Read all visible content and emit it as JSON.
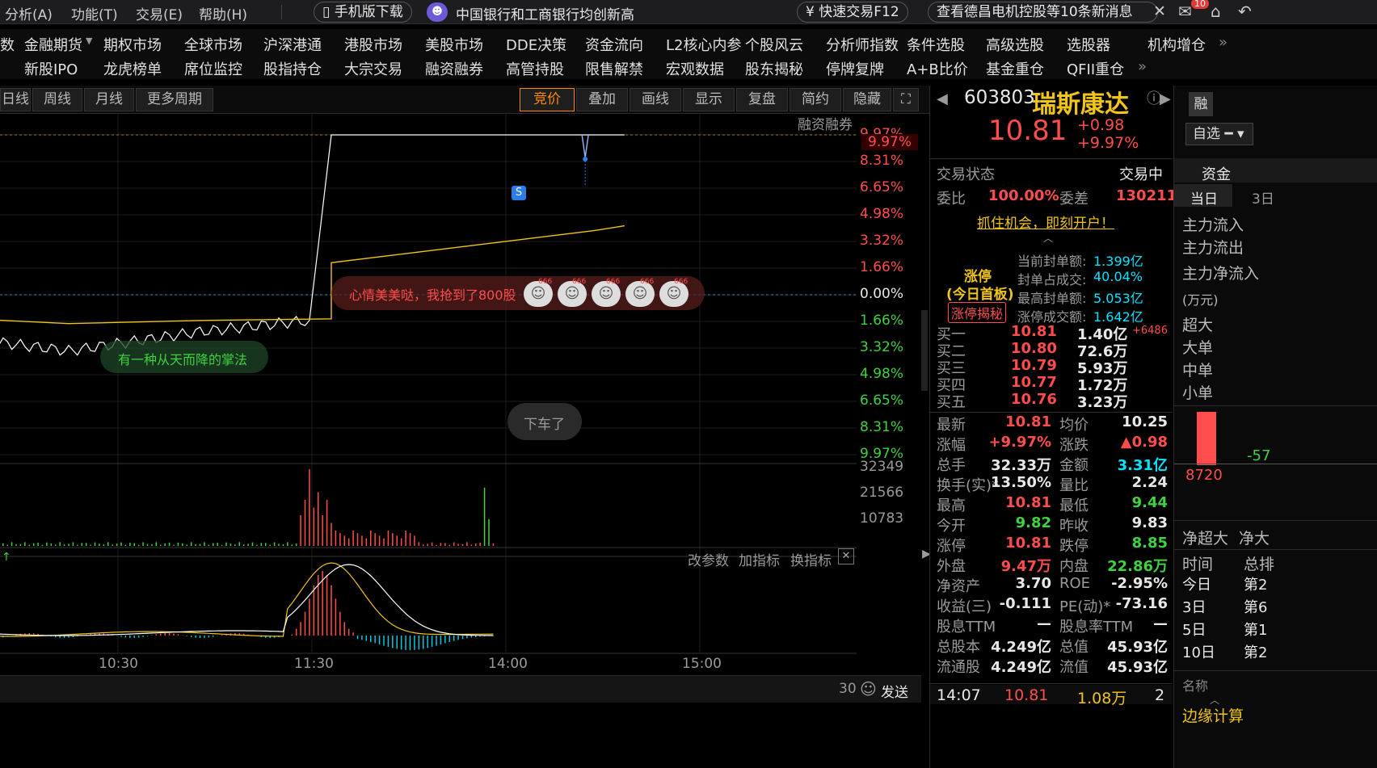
{
  "menu": {
    "items": [
      "分析(A)",
      "功能(T)",
      "交易(E)",
      "帮助(H)"
    ],
    "mobile_download": "手机版下载",
    "news_headline": "中国银行和工商银行均创新高",
    "quick_trade": "快速交易F12",
    "news_alert": "查看德昌电机控股等10条新消息",
    "mail_badge": "10"
  },
  "nav_row1": [
    "数",
    "金融期货",
    "期权市场",
    "全球市场",
    "沪深港通",
    "港股市场",
    "美股市场",
    "DDE决策",
    "资金流向",
    "L2核心内参",
    "个股风云",
    "分析师指数",
    "条件选股",
    "高级选股",
    "选股器",
    "机构增仓"
  ],
  "nav_row2": [
    "",
    "新股IPO",
    "龙虎榜单",
    "席位监控",
    "股指持仓",
    "大宗交易",
    "融资融券",
    "高管持股",
    "限售解禁",
    "宏观数据",
    "股东揭秘",
    "停牌复牌",
    "A+B比价",
    "基金重仓",
    "QFII重仓"
  ],
  "period_bar": {
    "left": [
      "日线",
      "周线",
      "月线",
      "更多周期"
    ],
    "right": [
      "竞价",
      "叠加",
      "画线",
      "显示",
      "复盘",
      "简约",
      "隐藏"
    ]
  },
  "chart": {
    "margin_label": "融资融券",
    "price_axis_labels": [
      "9.97%",
      "8.31%",
      "6.65%",
      "4.98%",
      "3.32%",
      "1.66%",
      "0.00%",
      "1.66%",
      "3.32%",
      "4.98%",
      "6.65%",
      "8.31%",
      "9.97%"
    ],
    "volume_axis_labels": [
      "32349",
      "21566",
      "10783"
    ],
    "time_labels": [
      "10:30",
      "11:30",
      "14:00",
      "15:00"
    ],
    "indicator_toolbar": [
      "改参数",
      "加指标",
      "换指标"
    ],
    "signal_marker": "S",
    "comments": {
      "happy": "心情美美哒，我抢到了800股",
      "palm": "有一种从天而降的掌法",
      "getoff": "下车了"
    },
    "emoji_badge": "666",
    "chat_count": "30",
    "send": "发送"
  },
  "chart_data": {
    "type": "line",
    "title": "",
    "x_range": [
      "09:30",
      "15:00"
    ],
    "y_range_pct": [
      -9.97,
      9.97
    ],
    "prev_close": 9.83,
    "series": [
      {
        "x": [
          "09:30",
          "10:00",
          "10:30",
          "11:00",
          "11:25",
          "11:30",
          "13:00",
          "13:30",
          "14:00",
          "14:07"
        ],
        "y_pct": [
          -1.3,
          -2.5,
          -3.5,
          -2.3,
          -1.6,
          9.97,
          9.97,
          9.97,
          9.97,
          9.97
        ]
      },
      {
        "x": [
          "09:30",
          "10:30",
          "11:00",
          "11:30",
          "13:00",
          "13:30",
          "14:00",
          "14:07"
        ],
        "y_pct": [
          -1.0,
          -1.8,
          -1.6,
          -1.5,
          2.0,
          3.0,
          4.0,
          4.3
        ]
      }
    ],
    "volume_max": 32349
  },
  "quote": {
    "code": "603803",
    "name": "瑞斯康达",
    "price": "10.81",
    "change": "+0.98",
    "pct": "+9.97%",
    "margin_tag": "融",
    "watchlist": "自选",
    "trade_status_label": "交易状态",
    "trade_status": "交易中",
    "wb_label": "委比",
    "wb": "100.00%",
    "wc_label": "委差",
    "wc": "130211",
    "open_account": "抓住机会，即刻开户！",
    "limit_up": {
      "title": "涨停",
      "subtitle": "(今日首板)",
      "button": "涨停揭秘",
      "rows": [
        [
          "当前封单额:",
          "1.399亿"
        ],
        [
          "封单占成交:",
          "40.04%"
        ],
        [
          "最高封单额:",
          "5.053亿"
        ],
        [
          "涨停成交额:",
          "1.642亿"
        ]
      ]
    },
    "bids": [
      [
        "买一",
        "10.81",
        "1.40亿",
        "+6486"
      ],
      [
        "买二",
        "10.80",
        "72.6万",
        ""
      ],
      [
        "买三",
        "10.79",
        "5.93万",
        ""
      ],
      [
        "买四",
        "10.77",
        "1.72万",
        ""
      ],
      [
        "买五",
        "10.76",
        "3.23万",
        ""
      ]
    ],
    "stats": [
      [
        "最新",
        "10.81",
        "均价",
        "10.25"
      ],
      [
        "涨幅",
        "+9.97%",
        "涨跌",
        "▲0.98"
      ],
      [
        "总手",
        "32.33万",
        "金额",
        "3.31亿"
      ],
      [
        "换手(实)*",
        "13.50%",
        "量比",
        "2.24"
      ],
      [
        "最高",
        "10.81",
        "最低",
        "9.44"
      ],
      [
        "今开",
        "9.82",
        "昨收",
        "9.83"
      ],
      [
        "涨停",
        "10.81",
        "跌停",
        "8.85"
      ],
      [
        "外盘",
        "9.47万",
        "内盘",
        "22.86万"
      ],
      [
        "净资产",
        "3.70",
        "ROE",
        "-2.95%"
      ],
      [
        "收益(三)",
        "-0.111",
        "PE(动)*",
        "-73.16"
      ],
      [
        "股息TTM",
        "—",
        "股息率TTM",
        "—"
      ],
      [
        "总股本",
        "4.249亿",
        "总值",
        "45.93亿"
      ],
      [
        "流通股",
        "4.249亿",
        "流值",
        "45.93亿"
      ]
    ],
    "tick": [
      "14:07",
      "10.81",
      "1.08万",
      "2"
    ]
  },
  "side": {
    "tab": "资金",
    "sub_tabs": [
      "当日",
      "3日"
    ],
    "flows": [
      "主力流入",
      "主力流出",
      "主力净流入"
    ],
    "unit": "(万元)",
    "sizes": [
      "超大",
      "大单",
      "中单",
      "小单"
    ],
    "bar_value": "8720",
    "bar_neg": "-57",
    "net": [
      "净超大",
      "净大"
    ],
    "period_header": [
      "时间",
      "总排"
    ],
    "periods": [
      [
        "今日",
        "第2"
      ],
      [
        "3日",
        "第6"
      ],
      [
        "5日",
        "第1"
      ],
      [
        "10日",
        "第2"
      ]
    ],
    "name_header": "名称",
    "bottom": "边缘计算"
  },
  "colors": {
    "up": "#ff4d4d",
    "down": "#3fd23f",
    "price_line": "#ffffff",
    "avg_line": "#f0c419",
    "accent": "#ff8a00"
  }
}
